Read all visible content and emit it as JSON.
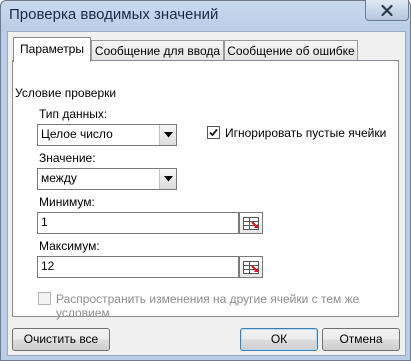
{
  "window": {
    "title": "Проверка вводимых значений"
  },
  "tabs": [
    {
      "label": "Параметры",
      "active": true
    },
    {
      "label": "Сообщение для ввода",
      "active": false
    },
    {
      "label": "Сообщение об ошибке",
      "active": false
    }
  ],
  "criteria": {
    "group_label": "Условие проверки",
    "data_type_label": "Тип данных:",
    "data_type_value": "Целое число",
    "ignore_blank_label": "Игнорировать пустые ячейки",
    "ignore_blank_checked": true,
    "data_label": "Значение:",
    "data_value": "между",
    "minimum_label": "Минимум:",
    "minimum_value": "1",
    "maximum_label": "Максимум:",
    "maximum_value": "12"
  },
  "apply_changes": {
    "label": "Распространить изменения на другие ячейки с тем же условием",
    "checked": false,
    "enabled": false
  },
  "buttons": {
    "clear_all": "Очистить все",
    "ok": "ОК",
    "cancel": "Отмена"
  },
  "icons": {
    "close": "close-icon",
    "dropdown": "chevron-down-icon",
    "range_picker": "range-picker-icon"
  }
}
